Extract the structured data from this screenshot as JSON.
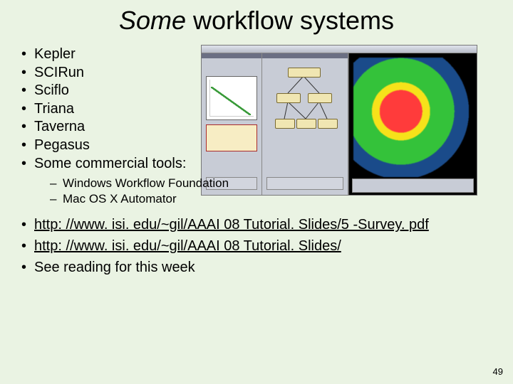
{
  "title_em": "Some",
  "title_rest": " workflow systems",
  "bullets": [
    "Kepler",
    "SCIRun",
    "Sciflo",
    "Triana",
    "Taverna",
    "Pegasus",
    "Some commercial tools:"
  ],
  "sub_bullets": [
    "Windows Workflow Foundation",
    "Mac OS X Automator"
  ],
  "links": [
    {
      "text": "http: //www. isi. edu/~gil/AAAI 08 Tutorial. Slides/5 -Survey. pdf",
      "is_link": true
    },
    {
      "text": "http: //www. isi. edu/~gil/AAAI 08 Tutorial. Slides/",
      "is_link": true
    },
    {
      "text": "See reading for this week",
      "is_link": false
    }
  ],
  "page_number": "49"
}
